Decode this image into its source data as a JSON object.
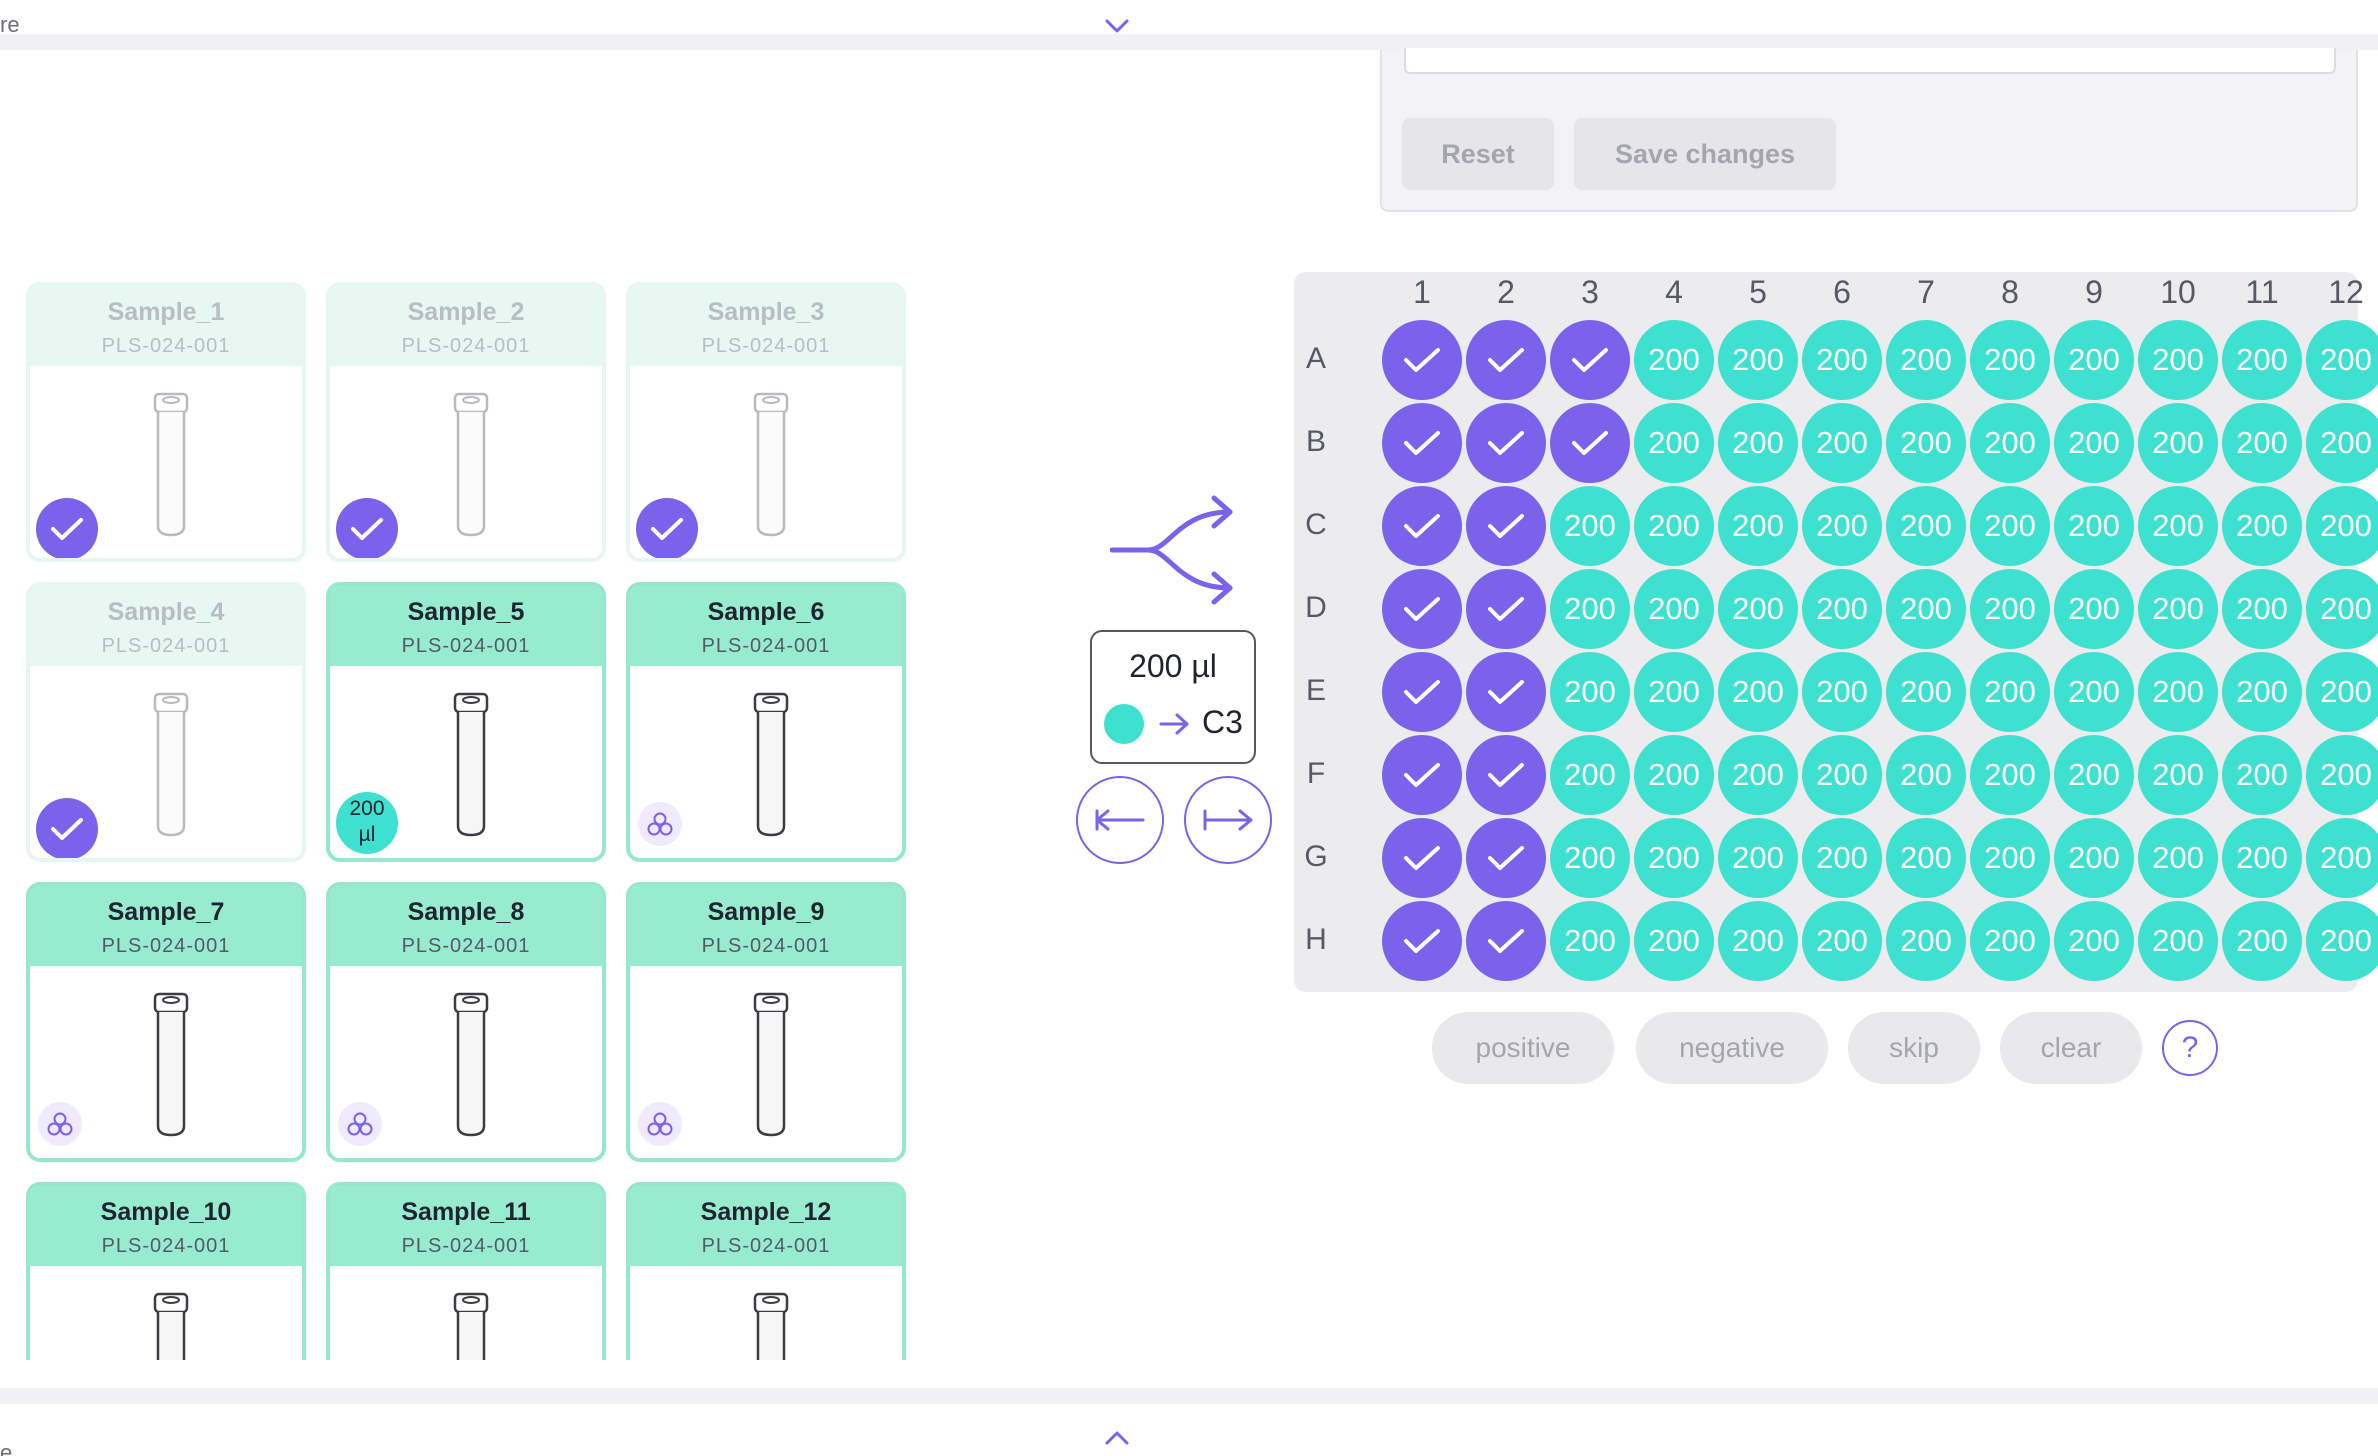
{
  "top_bar": {
    "label": "re",
    "icon": "chevron-down-icon"
  },
  "bottom_bar": {
    "label": "e",
    "icon": "chevron-up-icon"
  },
  "settings_panel": {
    "reset_label": "Reset",
    "save_label": "Save changes"
  },
  "samples": [
    {
      "name": "Sample_1",
      "code": "PLS-024-001",
      "status": "done"
    },
    {
      "name": "Sample_2",
      "code": "PLS-024-001",
      "status": "done"
    },
    {
      "name": "Sample_3",
      "code": "PLS-024-001",
      "status": "done"
    },
    {
      "name": "Sample_4",
      "code": "PLS-024-001",
      "status": "done"
    },
    {
      "name": "Sample_5",
      "code": "PLS-024-001",
      "status": "active",
      "volume_label_line1": "200",
      "volume_label_line2": "µl"
    },
    {
      "name": "Sample_6",
      "code": "PLS-024-001",
      "status": "pending"
    },
    {
      "name": "Sample_7",
      "code": "PLS-024-001",
      "status": "pending"
    },
    {
      "name": "Sample_8",
      "code": "PLS-024-001",
      "status": "pending"
    },
    {
      "name": "Sample_9",
      "code": "PLS-024-001",
      "status": "pending"
    },
    {
      "name": "Sample_10",
      "code": "PLS-024-001",
      "status": "pending"
    },
    {
      "name": "Sample_11",
      "code": "PLS-024-001",
      "status": "pending"
    },
    {
      "name": "Sample_12",
      "code": "PLS-024-001",
      "status": "pending"
    }
  ],
  "transfer": {
    "volume": "200 µl",
    "target_well": "C3",
    "icon": "split-arrows-icon"
  },
  "nav_buttons": {
    "left_icon": "arrow-left-bar-icon",
    "right_icon": "arrow-right-bar-icon"
  },
  "plate": {
    "columns": [
      "1",
      "2",
      "3",
      "4",
      "5",
      "6",
      "7",
      "8",
      "9",
      "10",
      "11",
      "12"
    ],
    "rows": [
      "A",
      "B",
      "C",
      "D",
      "E",
      "F",
      "G",
      "H"
    ],
    "fill_label": "200",
    "checked_columns_per_row": [
      3,
      3,
      2,
      2,
      2,
      2,
      2,
      2
    ]
  },
  "actions": {
    "positive": "positive",
    "negative": "negative",
    "skip": "skip",
    "clear": "clear",
    "help": "?"
  },
  "colors": {
    "accent": "#7a63ea",
    "filled": "#3ee0cf",
    "sample_header": "#97ebce"
  }
}
